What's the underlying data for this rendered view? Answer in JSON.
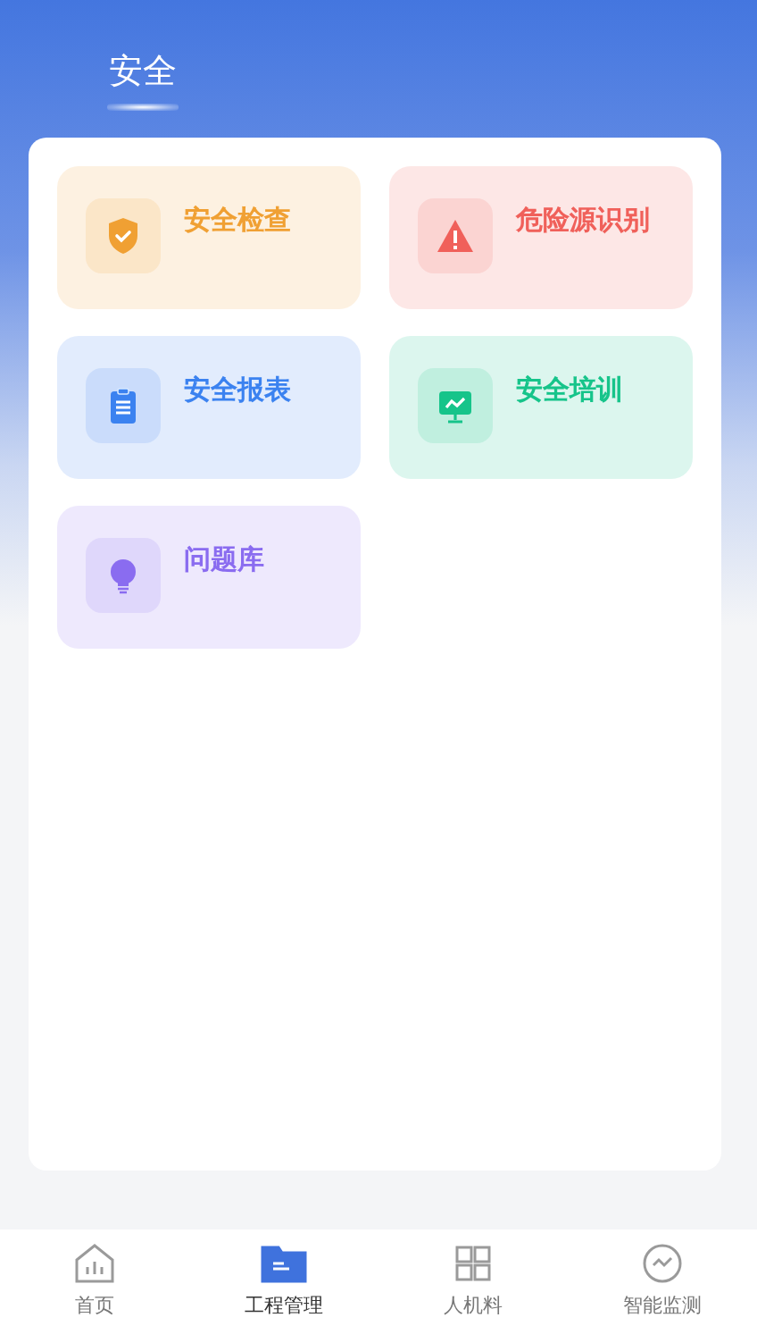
{
  "header": {
    "title": "安全"
  },
  "tiles": [
    {
      "label": "安全检查",
      "kind": "shield",
      "color": "#f0a033"
    },
    {
      "label": "危险源识别",
      "kind": "warning",
      "color": "#f0605a"
    },
    {
      "label": "安全报表",
      "kind": "clipboard",
      "color": "#3b82f0"
    },
    {
      "label": "安全培训",
      "kind": "monitor",
      "color": "#16c48a"
    },
    {
      "label": "问题库",
      "kind": "bulb",
      "color": "#8a6cf0"
    }
  ],
  "tab_bar": [
    {
      "label": "首页",
      "kind": "home",
      "selected": false
    },
    {
      "label": "工程管理",
      "kind": "folder",
      "selected": true
    },
    {
      "label": "人机料",
      "kind": "grid",
      "selected": false
    },
    {
      "label": "智能监测",
      "kind": "monitor",
      "selected": false
    }
  ]
}
